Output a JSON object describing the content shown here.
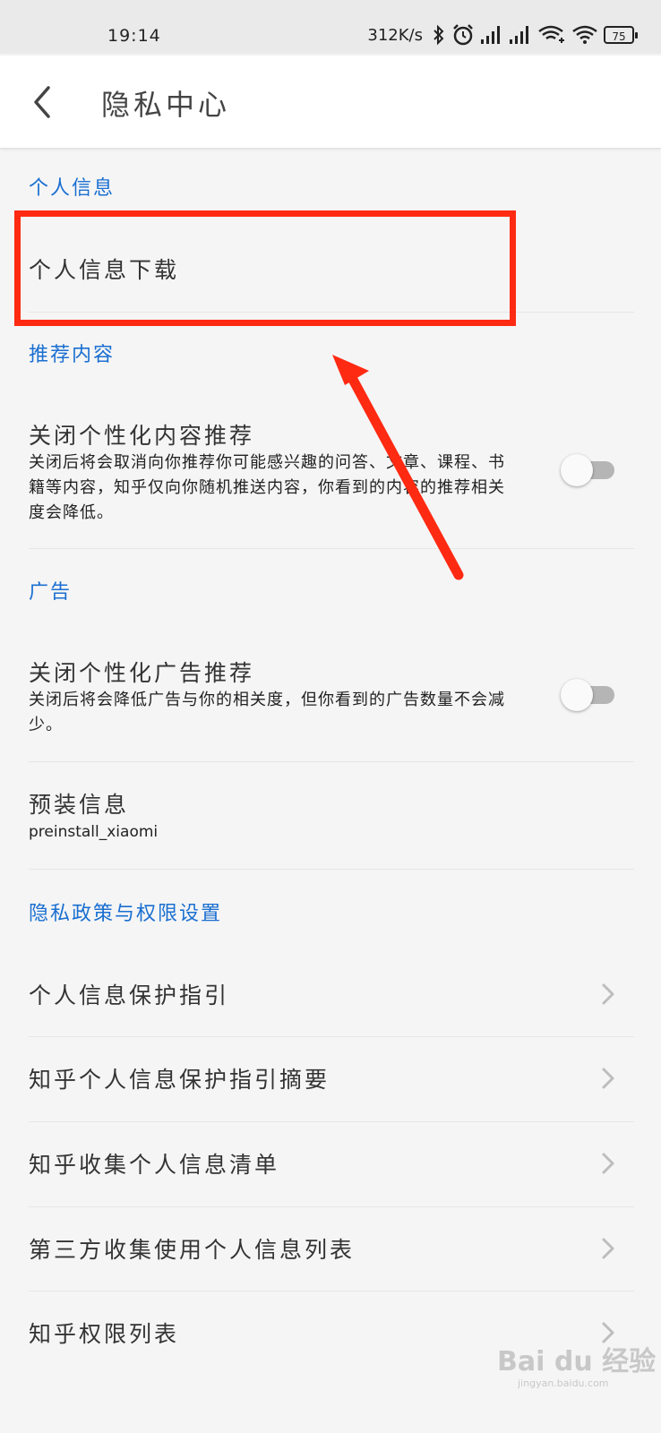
{
  "status_bar": {
    "time": "19:14",
    "speed": "312K/s",
    "battery": "75",
    "icons": [
      "bluetooth-icon",
      "alarm-icon",
      "signal-icon",
      "signal-icon",
      "wifi-call-icon",
      "wifi-icon",
      "battery-icon"
    ]
  },
  "header": {
    "title": "隐私中心",
    "back_icon": "back-arrow-icon"
  },
  "sections": {
    "personal_info": {
      "header": "个人信息",
      "download": "个人信息下载"
    },
    "recommend": {
      "header": "推荐内容",
      "title": "关闭个性化内容推荐",
      "desc": "关闭后将会取消向你推荐你可能感兴趣的问答、文章、课程、书籍等内容，知乎仅向你随机推送内容，你看到的内容的推荐相关度会降低。",
      "toggle_on": false
    },
    "ads": {
      "header": "广告",
      "title": "关闭个性化广告推荐",
      "desc": "关闭后将会降低广告与你的相关度，但你看到的广告数量不会减少。",
      "toggle_on": false,
      "preinstall_title": "预装信息",
      "preinstall_value": "preinstall_xiaomi"
    },
    "privacy": {
      "header": "隐私政策与权限设置",
      "items": [
        {
          "label": "个人信息保护指引"
        },
        {
          "label": "知乎个人信息保护指引摘要"
        },
        {
          "label": "知乎收集个人信息清单"
        },
        {
          "label": "第三方收集使用个人信息列表"
        },
        {
          "label": "知乎权限列表"
        }
      ]
    }
  },
  "watermark": {
    "brand": "Bai du 经验",
    "url": "jingyan.baidu.com"
  },
  "colors": {
    "accent_blue": "#1a6fd1",
    "highlight_red": "#ff2a12",
    "background": "#f5f5f5"
  }
}
